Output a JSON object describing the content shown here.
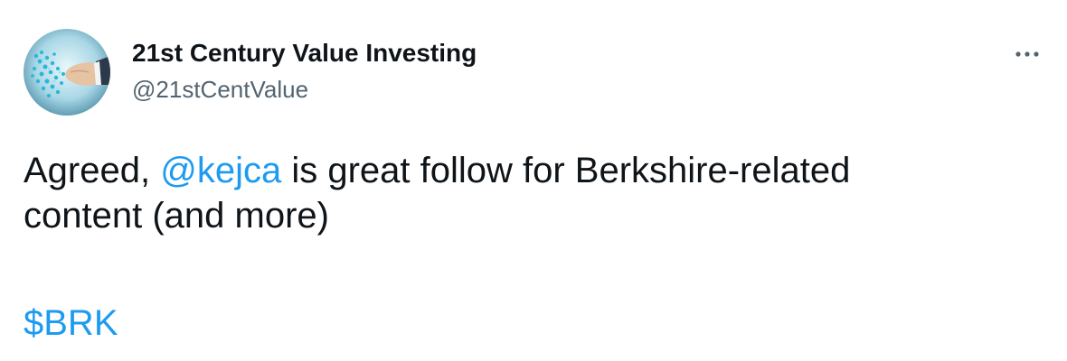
{
  "author": {
    "display_name": "21st Century Value Investing",
    "handle": "@21stCentValue",
    "avatar_icon": "avatar-handshake-icon"
  },
  "menu": {
    "icon": "more-horizontal-icon"
  },
  "tweet": {
    "line1_before": "Agreed, ",
    "mention": "@kejca",
    "line1_after": " is great follow for Berkshire-related",
    "line2": "content (and more)",
    "cashtag": "$BRK"
  },
  "colors": {
    "text": "#0f1419",
    "secondary_text": "#536471",
    "link": "#1d9bf0",
    "background": "#ffffff"
  }
}
